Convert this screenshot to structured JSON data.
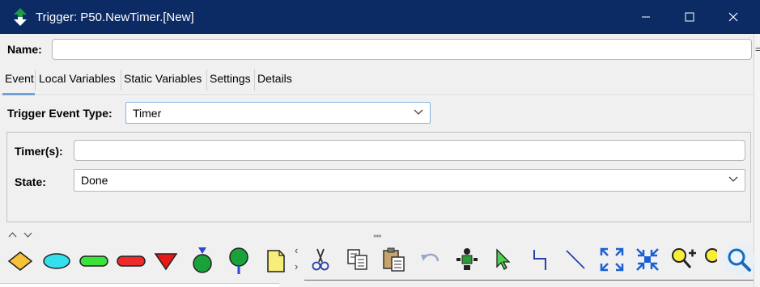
{
  "window": {
    "title": "Trigger: P50.NewTimer.[New]",
    "edge_mark": "="
  },
  "name_row": {
    "label": "Name:",
    "value": "",
    "placeholder": ""
  },
  "tabs": [
    {
      "label": "Event",
      "selected": true
    },
    {
      "label": "Local Variables",
      "selected": false
    },
    {
      "label": "Static Variables",
      "selected": false
    },
    {
      "label": "Settings",
      "selected": false
    },
    {
      "label": "Details",
      "selected": false
    }
  ],
  "event": {
    "trigger_type_label": "Trigger Event Type:",
    "trigger_type_value": "Timer",
    "timers_label": "Timer(s):",
    "timers_value": "",
    "state_label": "State:",
    "state_value": "Done"
  },
  "splitter": {
    "up": "^",
    "down": "v",
    "grip": "•••"
  },
  "palette": {
    "shapes": [
      "yellow-diamond",
      "cyan-ellipse",
      "green-rounded-rect",
      "red-rounded-rect",
      "red-triangle-down",
      "green-circle-blue-top",
      "green-pin",
      "yellow-document"
    ],
    "scroll_prev": "‹",
    "scroll_next": "›"
  },
  "toolbar": {
    "tools": [
      "cut-icon",
      "copy-icon",
      "paste-icon",
      "undo-icon",
      "move-icon",
      "select-arrow-icon",
      "connector-icon",
      "line-icon",
      "expand-icon",
      "shrink-icon",
      "zoom-in-icon",
      "zoom-icon"
    ]
  },
  "colors": {
    "title_bar": "#0c2b64",
    "tab_underline": "#6fa3d9",
    "panel_bg": "#f0f0f0"
  }
}
